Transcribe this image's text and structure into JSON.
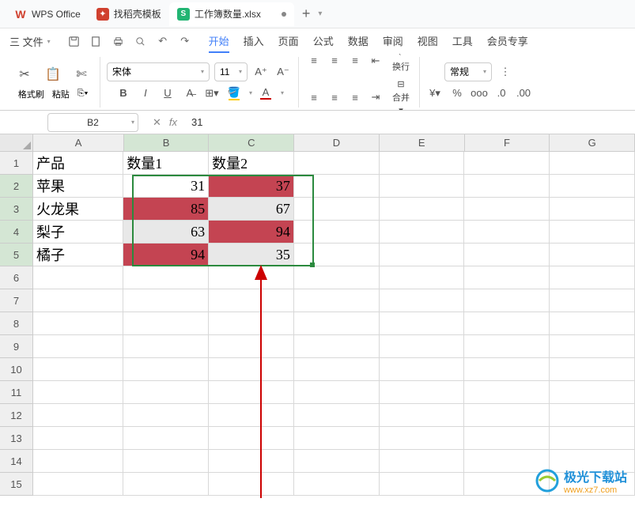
{
  "titlebar": {
    "app": "WPS Office",
    "template_tab": "找稻壳模板",
    "doc_tab": "工作簿数量.xlsx",
    "doc_badge": "S"
  },
  "menu": {
    "file": "三 文件",
    "tabs": [
      "开始",
      "插入",
      "页面",
      "公式",
      "数据",
      "审阅",
      "视图",
      "工具",
      "会员专享"
    ],
    "active": 0
  },
  "ribbon": {
    "format_brush": "格式刷",
    "paste": "粘贴",
    "font": "宋体",
    "size": "11",
    "wrap": "换行",
    "merge": "合并",
    "num_fmt": "常规"
  },
  "formula": {
    "cellref": "B2",
    "fx": "fx",
    "value": "31"
  },
  "sheet": {
    "cols": [
      "A",
      "B",
      "C",
      "D",
      "E",
      "F",
      "G"
    ],
    "headers": {
      "A": "产品",
      "B": "数量1",
      "C": "数量2"
    },
    "rows": [
      {
        "n": 1
      },
      {
        "n": 2,
        "A": "苹果",
        "B": "31",
        "C": "37",
        "B_hi": false,
        "C_hi": true
      },
      {
        "n": 3,
        "A": "火龙果",
        "B": "85",
        "C": "67",
        "B_hi": true,
        "C_hi": false
      },
      {
        "n": 4,
        "A": "梨子",
        "B": "63",
        "C": "94",
        "B_hi": false,
        "C_hi": true
      },
      {
        "n": 5,
        "A": "橘子",
        "B": "94",
        "C": "35",
        "B_hi": true,
        "C_hi": false
      }
    ]
  },
  "watermark": {
    "text": "极光下载站",
    "url": "www.xz7.com"
  },
  "chart_data": {
    "type": "table",
    "title": "",
    "columns": [
      "产品",
      "数量1",
      "数量2"
    ],
    "rows": [
      [
        "苹果",
        31,
        37
      ],
      [
        "火龙果",
        85,
        67
      ],
      [
        "梨子",
        63,
        94
      ],
      [
        "橘子",
        94,
        35
      ]
    ]
  }
}
